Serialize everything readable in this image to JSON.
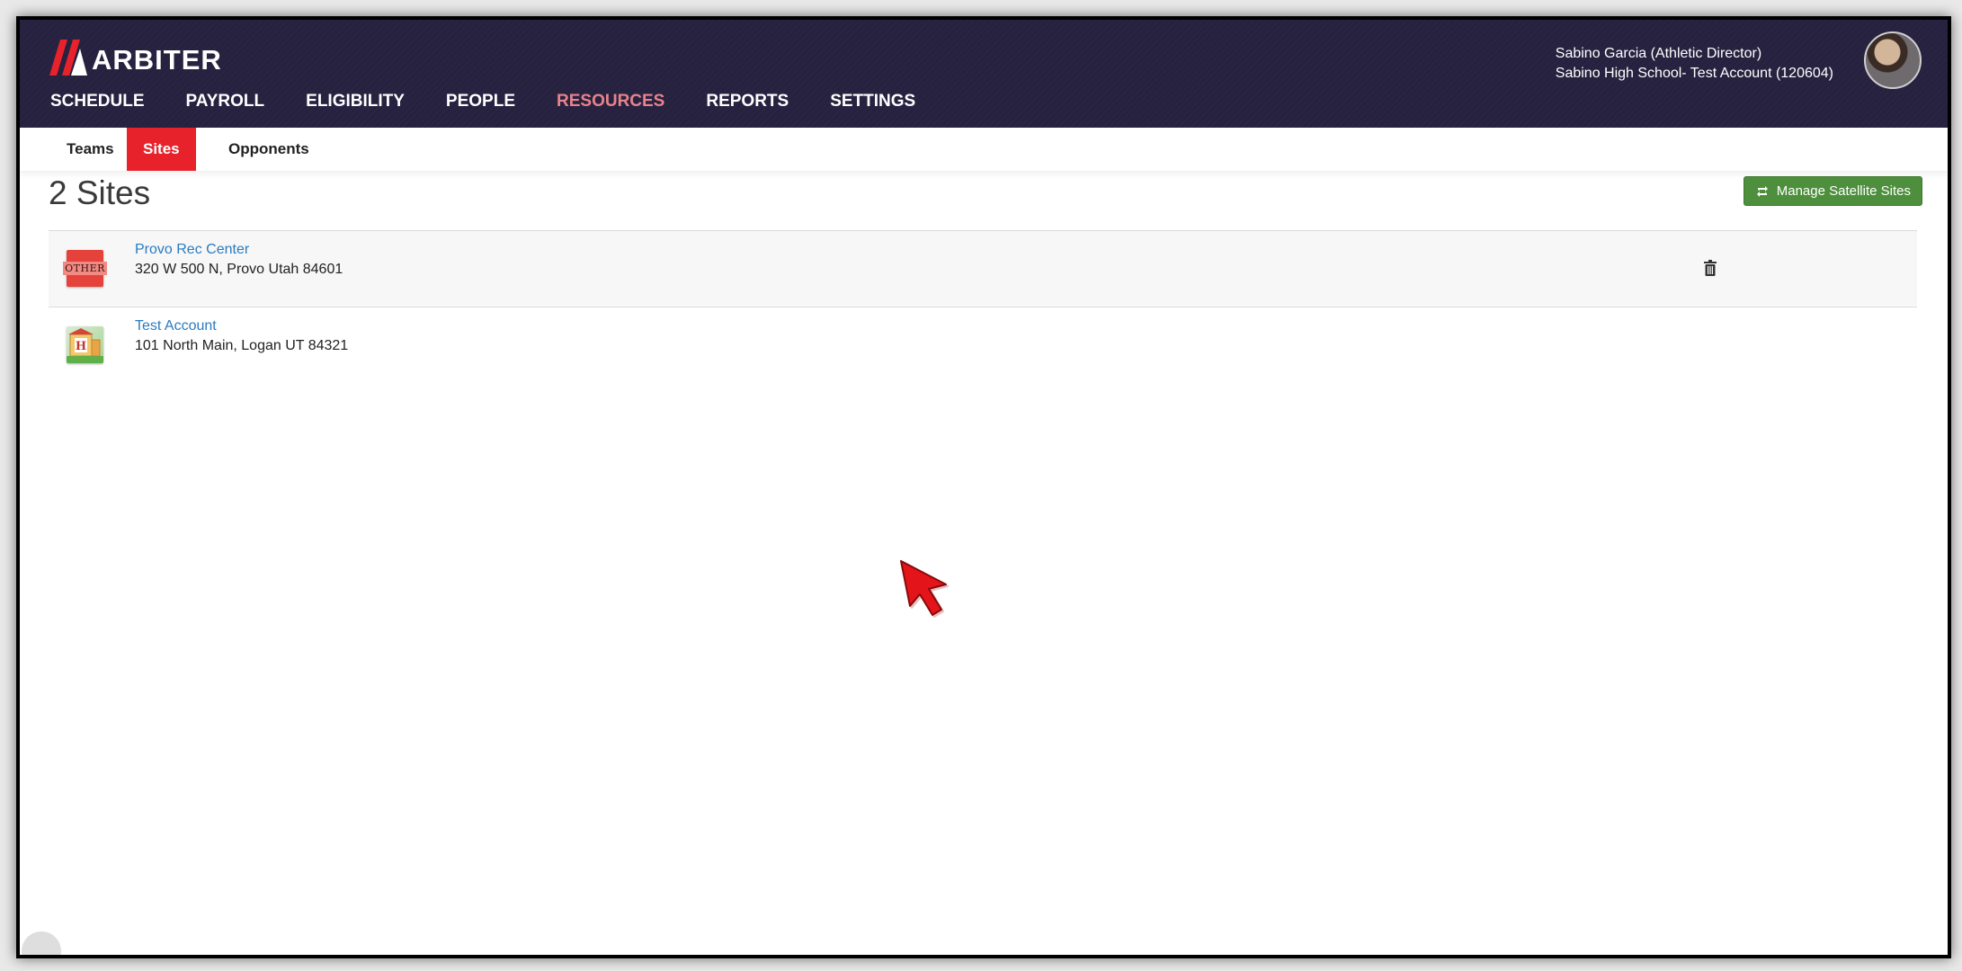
{
  "brand": {
    "logo_text": "ARBITER",
    "accent": "#e8222b",
    "nav_bg": "#25213f"
  },
  "main_nav": [
    {
      "label": "SCHEDULE",
      "active": false
    },
    {
      "label": "PAYROLL",
      "active": false
    },
    {
      "label": "ELIGIBILITY",
      "active": false
    },
    {
      "label": "PEOPLE",
      "active": false
    },
    {
      "label": "RESOURCES",
      "active": true
    },
    {
      "label": "REPORTS",
      "active": false
    },
    {
      "label": "SETTINGS",
      "active": false
    }
  ],
  "user": {
    "name_role": "Sabino Garcia (Athletic Director)",
    "organization": "Sabino High School- Test Account (120604)"
  },
  "sub_nav": [
    {
      "label": "Teams",
      "active": false
    },
    {
      "label": "Sites",
      "active": true
    },
    {
      "label": "Opponents",
      "active": false
    }
  ],
  "page": {
    "title": "2 Sites",
    "manage_button": "Manage Satellite Sites",
    "manage_button_color": "#4d8f3c"
  },
  "sites": [
    {
      "name": "Provo Rec Center",
      "address": "320 W 500 N, Provo Utah  84601",
      "icon": "other-venue-icon",
      "icon_text": "OTHER",
      "deletable": true
    },
    {
      "name": "Test Account",
      "address": "101 North Main, Logan UT  84321",
      "icon": "school-building-icon",
      "icon_text": "H",
      "deletable": false
    }
  ]
}
